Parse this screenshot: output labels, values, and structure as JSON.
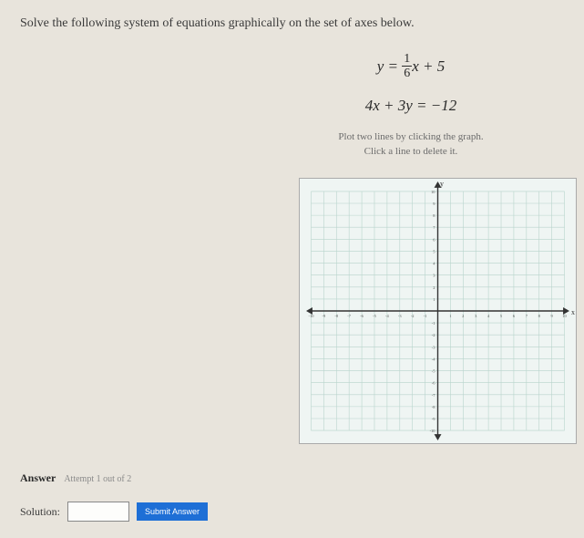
{
  "prompt": "Solve the following system of equations graphically on the set of axes below.",
  "equation1": {
    "lhs": "y",
    "eq": " = ",
    "frac_num": "1",
    "frac_den": "6",
    "after": "x + 5"
  },
  "equation2": "4x + 3y = −12",
  "instruction_line1": "Plot two lines by clicking the graph.",
  "instruction_line2": "Click a line to delete it.",
  "axes": {
    "xlabel": "x",
    "ylabel": "y",
    "min": -10,
    "max": 10,
    "ticks": [
      -10,
      -9,
      -8,
      -7,
      -6,
      -5,
      -4,
      -3,
      -2,
      -1,
      1,
      2,
      3,
      4,
      5,
      6,
      7,
      8,
      9,
      10
    ]
  },
  "answer_label": "Answer",
  "attempt_text": "Attempt 1 out of 2",
  "solution_label": "Solution:",
  "solution_value": "",
  "submit_label": "Submit Answer",
  "chart_data": {
    "type": "scatter",
    "title": "",
    "xlabel": "x",
    "ylabel": "y",
    "xlim": [
      -10,
      10
    ],
    "ylim": [
      -10,
      10
    ],
    "series": []
  }
}
